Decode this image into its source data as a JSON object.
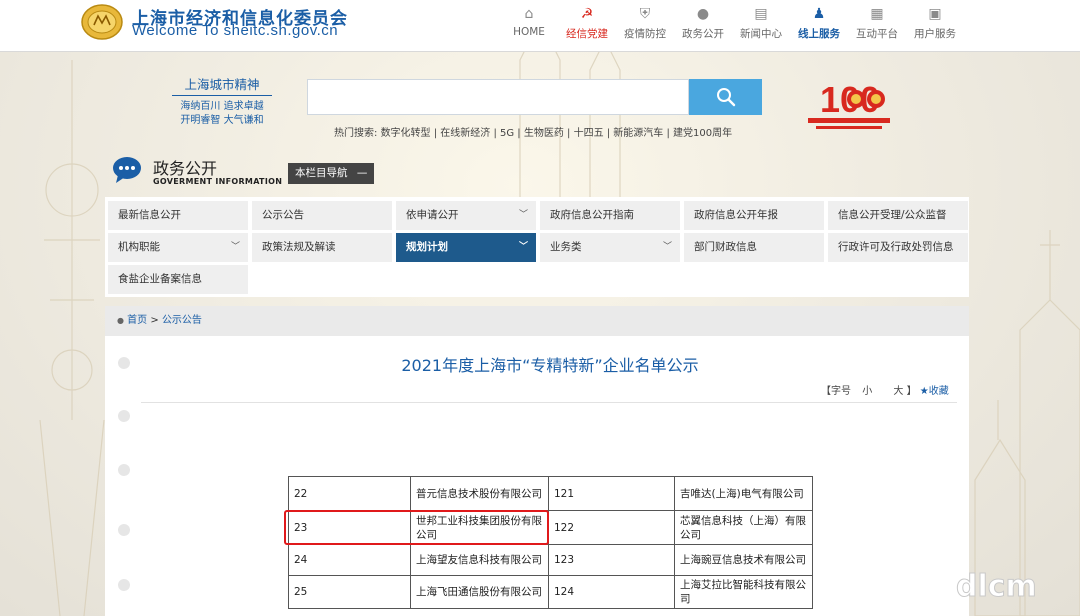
{
  "header": {
    "title": "上海市经济和信息化委员会",
    "subtitle": "Welcome To sheitc.sh.gov.cn",
    "nav": [
      {
        "icon": "home-icon",
        "label": "HOME",
        "glyph": "⌂"
      },
      {
        "icon": "party-icon",
        "label": "经信党建",
        "glyph": "☭"
      },
      {
        "icon": "shield-icon",
        "label": "疫情防控",
        "glyph": "⛨"
      },
      {
        "icon": "chat-icon",
        "label": "政务公开",
        "glyph": "●"
      },
      {
        "icon": "news-icon",
        "label": "新闻中心",
        "glyph": "▤"
      },
      {
        "icon": "people-icon",
        "label": "线上服务",
        "glyph": "♟"
      },
      {
        "icon": "grid-icon",
        "label": "互动平台",
        "glyph": "▦"
      },
      {
        "icon": "user-service-icon",
        "label": "用户服务",
        "glyph": "▣"
      }
    ]
  },
  "slogan": {
    "title": "上海城市精神",
    "line1": "海纳百川 追求卓越",
    "line2": "开明睿智 大气谦和"
  },
  "search": {
    "placeholder": "",
    "hot_label": "热门搜索:",
    "hot_terms": "数字化转型 | 在线新经济 | 5G | 生物医药 | 十四五 | 新能源汽车 | 建党100周年"
  },
  "section": {
    "title": "政务公开",
    "subtitle": "GOVERMENT INFORMATION",
    "nav_button": "本栏目导航",
    "nav_button_symbol": "—"
  },
  "menu": [
    {
      "label": "最新信息公开",
      "dropdown": false
    },
    {
      "label": "公示公告",
      "dropdown": false
    },
    {
      "label": "依申请公开",
      "dropdown": true
    },
    {
      "label": "政府信息公开指南",
      "dropdown": false
    },
    {
      "label": "政府信息公开年报",
      "dropdown": false
    },
    {
      "label": "信息公开受理/公众监督",
      "dropdown": false
    },
    {
      "label": "机构职能",
      "dropdown": true
    },
    {
      "label": "政策法规及解读",
      "dropdown": false
    },
    {
      "label": "规划计划",
      "dropdown": true
    },
    {
      "label": "业务类",
      "dropdown": true
    },
    {
      "label": "部门财政信息",
      "dropdown": false
    },
    {
      "label": "行政许可及行政处罚信息",
      "dropdown": false
    },
    {
      "label": "食盐企业备案信息",
      "dropdown": false
    }
  ],
  "breadcrumb": {
    "home": "首页",
    "sep": ">",
    "current": "公示公告"
  },
  "article": {
    "title": "2021年度上海市“专精特新”企业名单公示",
    "font_label": "【字号",
    "small": "小",
    "big": "大",
    "close_bracket": "】",
    "favorite": "★收藏"
  },
  "table_rows": [
    {
      "n1": "22",
      "c1": "普元信息技术股份有限公司",
      "n2": "121",
      "c2": "吉唯达(上海)电气有限公司"
    },
    {
      "n1": "23",
      "c1": "世邦工业科技集团股份有限公司",
      "n2": "122",
      "c2": "芯翼信息科技（上海）有限公司"
    },
    {
      "n1": "24",
      "c1": "上海望友信息科技有限公司",
      "n2": "123",
      "c2": "上海豌豆信息技术有限公司"
    },
    {
      "n1": "25",
      "c1": "上海飞田通信股份有限公司",
      "n2": "124",
      "c2": "上海艾拉比智能科技有限公司"
    }
  ],
  "colors": {
    "brand": "#1b5ea6",
    "active_menu": "#1e5a8c",
    "highlight": "#e0191b",
    "search_button": "#4aa7df"
  }
}
